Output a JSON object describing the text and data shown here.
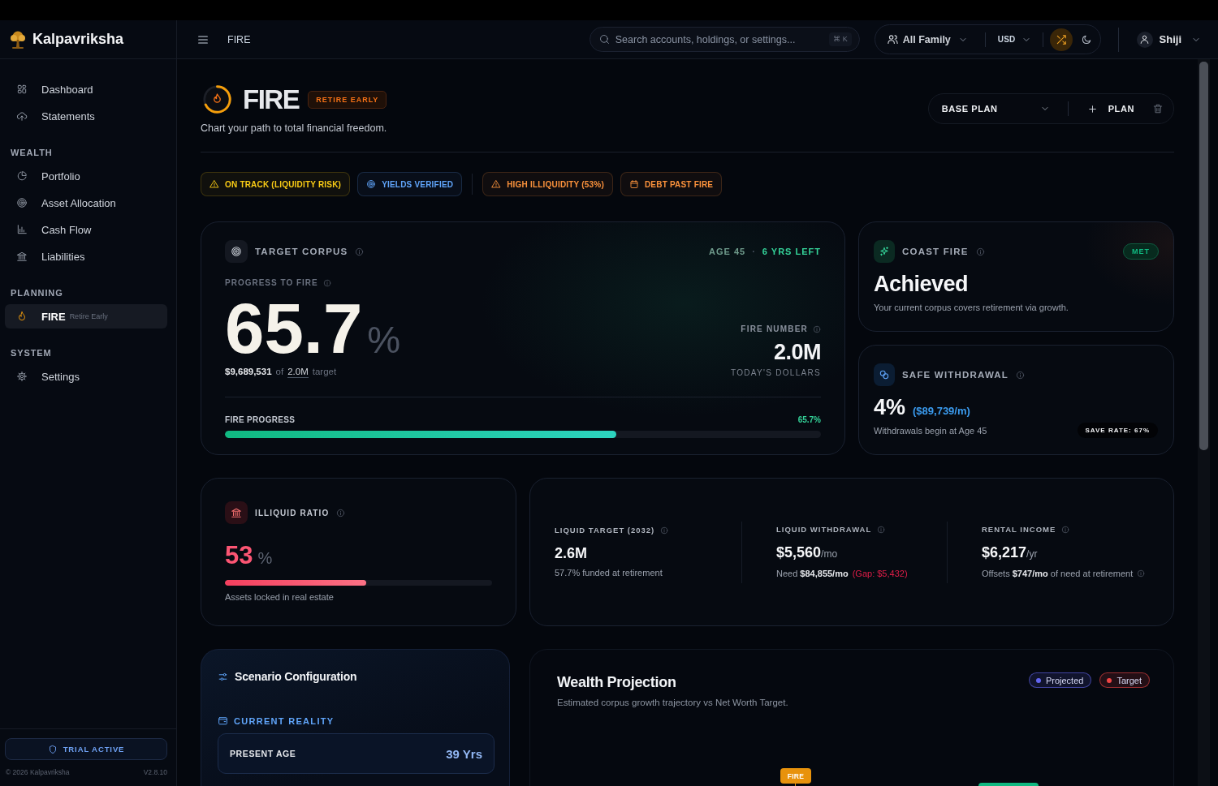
{
  "brand": {
    "name": "Kalpavriksha"
  },
  "topbar": {
    "breadcrumb": "FIRE",
    "search": {
      "placeholder": "Search accounts, holdings, or settings...",
      "shortcut": "⌘ K"
    },
    "family_filter": "All Family",
    "currency": "USD",
    "shuffle": {
      "on": true
    },
    "user": {
      "name": "Shiji"
    }
  },
  "sidebar": {
    "sections": [
      {
        "items": [
          {
            "label": "Dashboard",
            "selected": false
          },
          {
            "label": "Statements",
            "selected": false
          }
        ]
      },
      {
        "title": "WEALTH",
        "items": [
          {
            "label": "Portfolio",
            "selected": false
          },
          {
            "label": "Asset Allocation",
            "selected": false
          },
          {
            "label": "Cash Flow",
            "selected": false
          },
          {
            "label": "Liabilities",
            "selected": false
          }
        ]
      },
      {
        "title": "PLANNING",
        "items": [
          {
            "label": "FIRE",
            "sublabel": "Retire Early",
            "selected": true
          }
        ]
      },
      {
        "title": "SYSTEM",
        "items": [
          {
            "label": "Settings",
            "selected": false
          }
        ]
      }
    ],
    "trial_button": "TRIAL ACTIVE",
    "copyright": "© 2026 Kalpavriksha",
    "version": "V2.8.10"
  },
  "page_header": {
    "title": "FIRE",
    "tag": "RETIRE EARLY",
    "subtitle": "Chart your path to total financial freedom.",
    "plan_select": "BASE PLAN",
    "add_button": "PLAN"
  },
  "badge_groups": [
    {
      "badges": [
        {
          "kind": "warning",
          "label": "ON TRACK (LIQUIDITY RISK)",
          "color": "#facc15"
        },
        {
          "kind": "target",
          "label": "YIELDS VERIFIED",
          "color": "#60a5fa"
        }
      ]
    },
    {
      "badges": [
        {
          "kind": "warning",
          "label": "HIGH ILLIQUIDITY (53%)",
          "color": "#fb923c"
        },
        {
          "kind": "calendar",
          "label": "DEBT PAST FIRE",
          "color": "#fb923c"
        }
      ]
    }
  ],
  "target_corpus": {
    "title": "TARGET CORPUS",
    "age": "AGE 45",
    "separator": "·",
    "years_left": "6 YRS LEFT",
    "progress_label": "PROGRESS TO FIRE",
    "progress_value": "65.7",
    "progress_unit": "%",
    "corpus": "$9,689,531",
    "of_word": "of",
    "target_amount": "2.0M",
    "target_word": "target",
    "fire_number_label": "FIRE NUMBER",
    "fire_number": "2.0M",
    "fire_number_note": "TODAY'S DOLLARS",
    "bar": {
      "label": "FIRE PROGRESS",
      "reading": "65.7%",
      "level": 0.657
    }
  },
  "coast_fire": {
    "title": "COAST FIRE",
    "status": "MET",
    "headline": "Achieved",
    "description": "Your current corpus covers retirement via growth."
  },
  "safe_withdrawal": {
    "title": "SAFE WITHDRAWAL",
    "rate": "4%",
    "amount": "($89,739/m)",
    "note": "Withdrawals begin at Age 45",
    "save_rate": "SAVE RATE: 67%"
  },
  "illiquid_ratio": {
    "title": "ILLIQUID RATIO",
    "value": "53",
    "unit": "%",
    "level": 0.53,
    "note": "Assets locked in real estate"
  },
  "liquidity_stats": [
    {
      "label": "LIQUID TARGET (2032)",
      "value": "2.6M",
      "note": "57.7% funded at retirement",
      "note_info": false
    },
    {
      "label": "LIQUID WITHDRAWAL",
      "value": "$5,560",
      "unit": "/mo",
      "note": "Need **$84,855/mo**",
      "gap": "(Gap: $5,432)",
      "note_info": false
    },
    {
      "label": "RENTAL INCOME",
      "value": "$6,217",
      "unit": "/yr",
      "note": "Offsets **$747/mo** of need at retirement",
      "note_info": true
    }
  ],
  "scenario": {
    "title": "Scenario Configuration",
    "section": "CURRENT REALITY",
    "fields": [
      {
        "label": "PRESENT AGE",
        "value": "39 Yrs"
      }
    ]
  },
  "wealth_projection": {
    "title": "Wealth Projection",
    "subtitle": "Estimated corpus growth trajectory vs Net Worth Target.",
    "legend": [
      {
        "label": "Projected",
        "color": "#6366f1"
      },
      {
        "label": "Target",
        "color": "#ef4444"
      }
    ],
    "fire_marker": "FIRE"
  }
}
